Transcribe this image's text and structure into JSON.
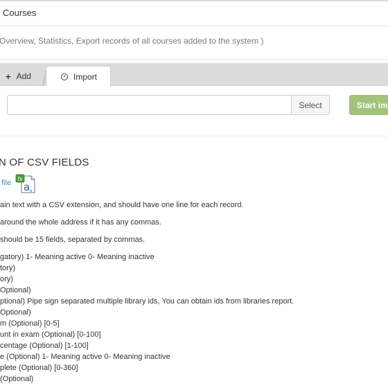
{
  "header": {
    "title": "Courses",
    "subtitle": "Overview, Statistics, Export records of all courses added to the system )"
  },
  "tabs": {
    "add_label": "Add",
    "import_label": "Import"
  },
  "import_form": {
    "file_value": "",
    "select_label": "Select",
    "start_label": "Start imp"
  },
  "fields_section": {
    "title": "N OF CSV FIELDS",
    "sample_link": "file",
    "sample_icon": "excel-file-icon",
    "lines": [
      "ain text with a CSV extension, and should have one line for each record.",
      "around the whole address if it has any commas.",
      "should be 15 fields, separated by commas."
    ],
    "fields": [
      "gatory) 1- Meaning active 0- Meaning inactive",
      "tory)",
      "ory)",
      "Optional)",
      "ptional) Pipe sign separated multiple library ids, You can obtain ids from libraries report.",
      "Optional)",
      "m (Optional) [0-5]",
      "unt in exam (Optional) [0-100]",
      "centage (Optional) [1-100]",
      "e (Optional) 1- Meaning active 0- Meaning inactive",
      "plete (Optional) [0-360]",
      "(Optional)"
    ]
  },
  "colors": {
    "link": "#3c8dbc",
    "start_button": "#a2c37a",
    "tabbar": "#dcdcdc"
  }
}
